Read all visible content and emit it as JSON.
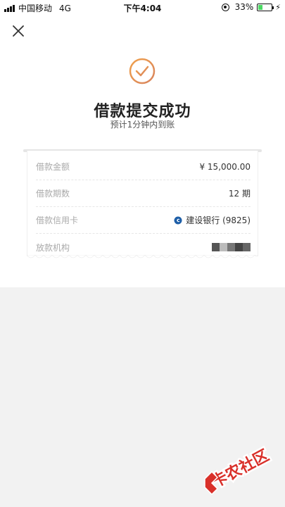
{
  "status_bar": {
    "carrier": "中国移动",
    "network": "4G",
    "time": "下午4:04",
    "battery": "33%",
    "battery_level": 0.33
  },
  "header": {
    "title": "借款提交成功",
    "subtitle": "预计1分钟内到账"
  },
  "details": [
    {
      "label": "借款金额",
      "value": "¥ 15,000.00"
    },
    {
      "label": "借款期数",
      "value": "12 期"
    },
    {
      "label": "借款信用卡",
      "value": "建设银行 (9825)"
    },
    {
      "label": "放款机构",
      "value": ""
    }
  ],
  "watermark": {
    "text": "卡农社区"
  },
  "colors": {
    "accent": "#e8935a",
    "bank_icon": "#1f5fa8",
    "watermark": "#d9302a"
  }
}
